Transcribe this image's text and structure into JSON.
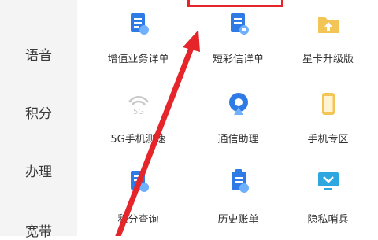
{
  "sidebar": {
    "items": [
      {
        "label": "语音",
        "icon": ""
      },
      {
        "label": "积分",
        "icon": ""
      },
      {
        "label": "办理",
        "icon": ""
      },
      {
        "label": "宽带",
        "icon": ""
      }
    ]
  },
  "services": [
    {
      "label": "增值业务详单",
      "icon": "document-blue-icon"
    },
    {
      "label": "短彩信详单",
      "icon": "message-document-icon"
    },
    {
      "label": "星卡升级版",
      "icon": "folder-upload-icon"
    },
    {
      "label": "5G手机测速",
      "icon": "5g-signal-icon"
    },
    {
      "label": "通信助理",
      "icon": "assistant-antenna-icon"
    },
    {
      "label": "手机专区",
      "icon": "phone-icon"
    },
    {
      "label": "积分查询",
      "icon": "points-query-icon"
    },
    {
      "label": "历史账单",
      "icon": "history-bill-icon"
    },
    {
      "label": "隐私哨兵",
      "icon": "privacy-monitor-icon"
    }
  ],
  "colors": {
    "accent_blue": "#2f7be6",
    "annotation_red": "#e5252a",
    "sidebar_bg": "#f4f4f4",
    "folder_yellow": "#f3c556"
  }
}
